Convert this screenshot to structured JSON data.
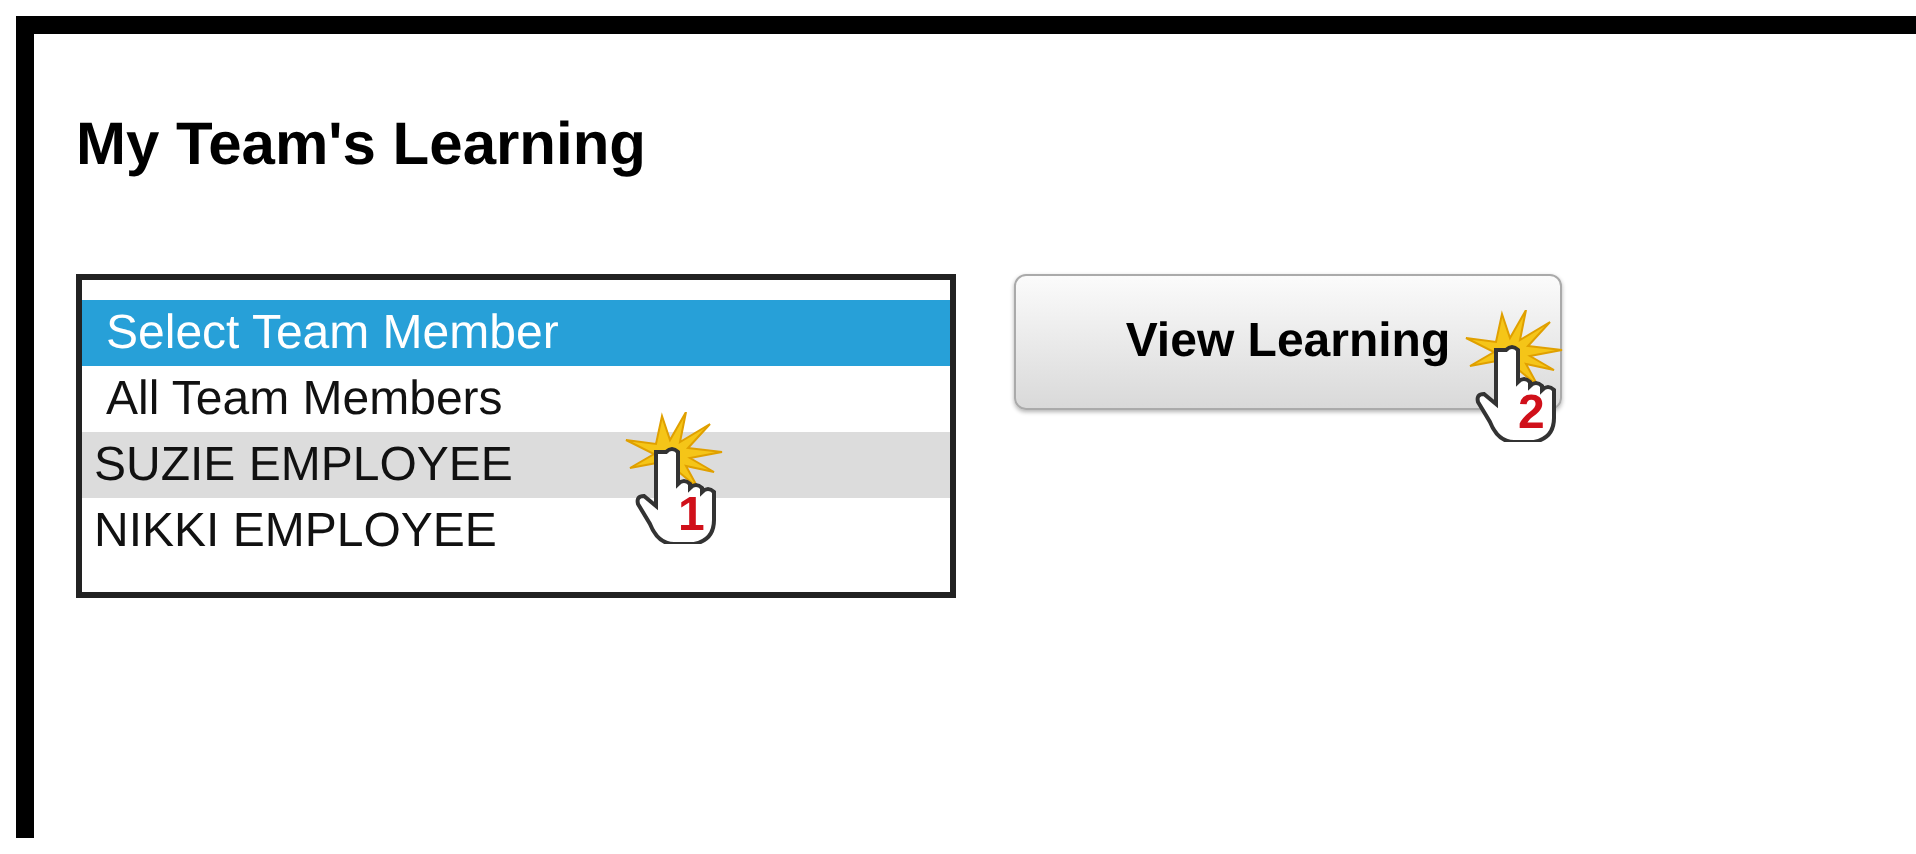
{
  "heading": "My Team's Learning",
  "team_list": {
    "options": [
      {
        "label": "Select Team Member",
        "selected": true,
        "hovered": false
      },
      {
        "label": "All Team Members",
        "selected": false,
        "hovered": false
      },
      {
        "label": "SUZIE EMPLOYEE",
        "selected": false,
        "hovered": true,
        "callout": "1"
      },
      {
        "label": "NIKKI EMPLOYEE",
        "selected": false,
        "hovered": false
      }
    ]
  },
  "view_button": {
    "label": "View Learning",
    "callout": "2"
  }
}
